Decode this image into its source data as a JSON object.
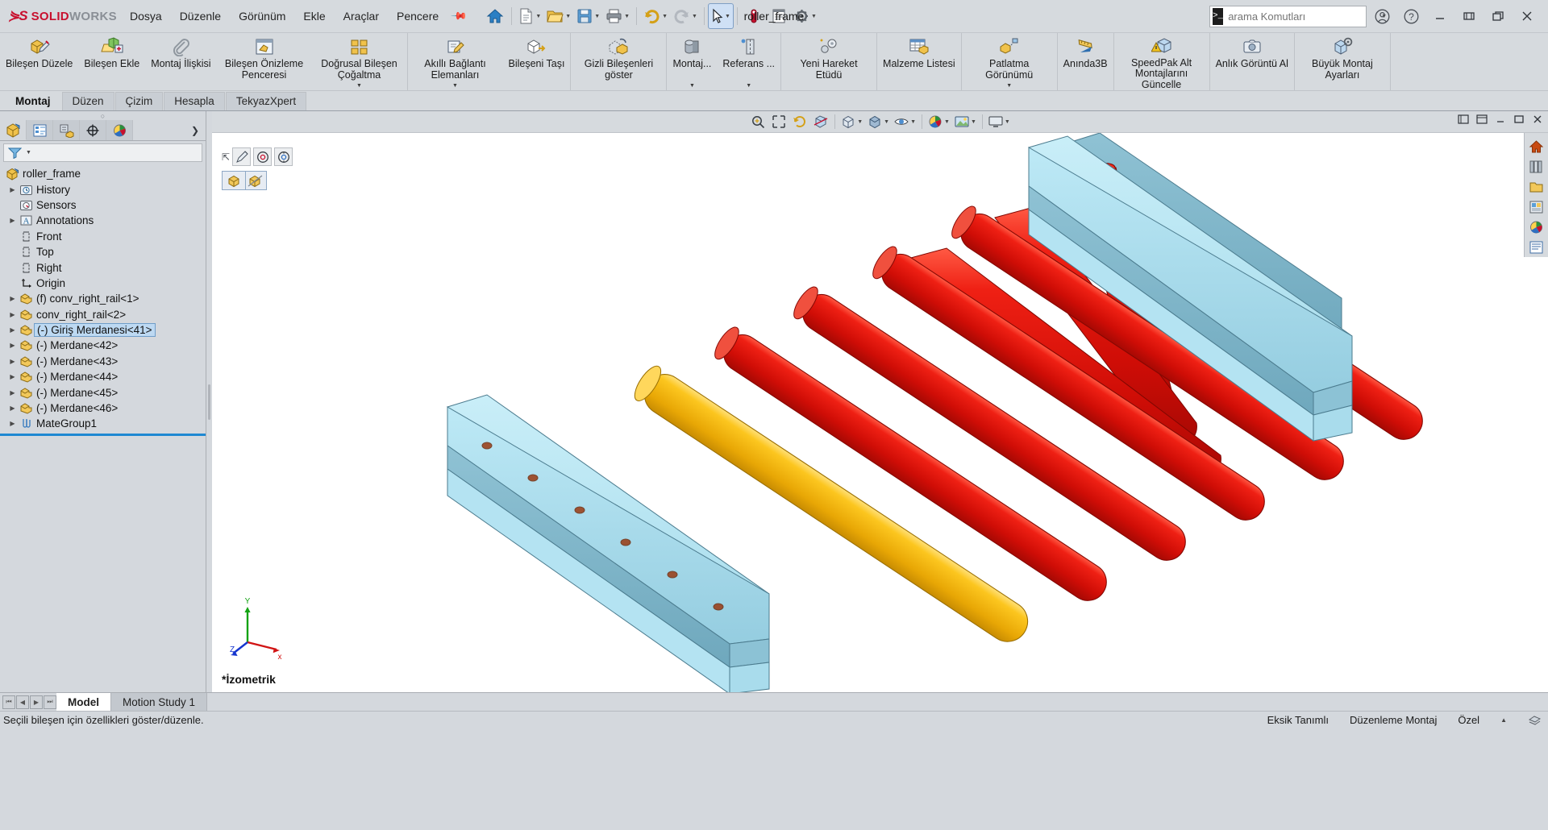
{
  "app": {
    "brand_ds": "2S",
    "brand_name_bold": "SOLID",
    "brand_name_light": "WORKS",
    "document_title": "roller_frame"
  },
  "menu": {
    "items": [
      {
        "label": "Dosya"
      },
      {
        "label": "Düzenle"
      },
      {
        "label": "Görünüm"
      },
      {
        "label": "Ekle"
      },
      {
        "label": "Araçlar"
      },
      {
        "label": "Pencere"
      }
    ],
    "pin_icon": "pushpin-icon"
  },
  "quick_access": [
    {
      "name": "home-icon",
      "label": "Ana Sayfa",
      "glyph": "home"
    },
    {
      "name": "new-document-icon",
      "label": "Yeni",
      "glyph": "newdoc",
      "dropdown": true
    },
    {
      "name": "open-folder-icon",
      "label": "Aç",
      "glyph": "open",
      "dropdown": true
    },
    {
      "name": "save-icon",
      "label": "Kaydet",
      "glyph": "save",
      "dropdown": true
    },
    {
      "name": "print-icon",
      "label": "Yazdır",
      "glyph": "print",
      "dropdown": true
    },
    {
      "name": "undo-icon",
      "label": "Geri Al",
      "glyph": "undo",
      "dropdown": true
    },
    {
      "name": "redo-icon",
      "label": "Yinele",
      "glyph": "redo",
      "dropdown": true
    },
    {
      "name": "select-cursor-icon",
      "label": "Seç",
      "glyph": "cursor",
      "dropdown": true,
      "selected": true
    },
    {
      "name": "measure-icon",
      "label": "Ölç",
      "glyph": "measure"
    },
    {
      "name": "display-panel-icon",
      "label": "Görüntü Paneli",
      "glyph": "panel"
    },
    {
      "name": "options-gear-icon",
      "label": "Seçenekler",
      "glyph": "gear",
      "dropdown": true
    }
  ],
  "search": {
    "placeholder": "arama Komutları",
    "value": "",
    "terminal_glyph": "❯_",
    "search_icon": "search-icon",
    "dropdown_icon": "chevron-down-icon"
  },
  "window_controls": [
    {
      "name": "account-icon",
      "glyph": "account"
    },
    {
      "name": "help-icon",
      "glyph": "help"
    },
    {
      "name": "minimize-button",
      "glyph": "minimize"
    },
    {
      "name": "restore-button",
      "glyph": "restore"
    },
    {
      "name": "maximize-button",
      "glyph": "maximize"
    },
    {
      "name": "close-button",
      "glyph": "close"
    }
  ],
  "ribbon": {
    "groups": [
      {
        "buttons": [
          {
            "name": "edit-component-button",
            "icon": "edit-component-icon",
            "label": "Bileşen Düzele"
          },
          {
            "name": "insert-component-button",
            "icon": "insert-component-icon",
            "label": "Bileşen Ekle"
          },
          {
            "name": "mate-button",
            "icon": "mate-paperclip-icon",
            "label": "Montaj İlişkisi"
          },
          {
            "name": "component-preview-button",
            "icon": "component-preview-icon",
            "label": "Bileşen Önizleme Penceresi"
          },
          {
            "name": "linear-component-pattern-button",
            "icon": "linear-pattern-icon",
            "label": "Doğrusal Bileşen Çoğaltma",
            "dropdown": true
          }
        ]
      },
      {
        "buttons": [
          {
            "name": "smart-fasteners-button",
            "icon": "smart-fasteners-icon",
            "label": "Akıllı Bağlantı Elemanları",
            "dropdown": true
          },
          {
            "name": "move-component-button",
            "icon": "move-component-icon",
            "label": "Bileşeni Taşı"
          }
        ]
      },
      {
        "buttons": [
          {
            "name": "show-hidden-components-button",
            "icon": "hidden-components-icon",
            "label": "Gizli Bileşenleri göster"
          }
        ]
      },
      {
        "buttons": [
          {
            "name": "assembly-features-button",
            "icon": "assembly-features-icon",
            "label": "Montaj...",
            "dropdown": true
          },
          {
            "name": "reference-geometry-button",
            "icon": "reference-geometry-icon",
            "label": "Referans ...",
            "dropdown": true
          }
        ]
      },
      {
        "buttons": [
          {
            "name": "new-motion-study-button",
            "icon": "motion-study-icon",
            "label": "Yeni Hareket Etüdü"
          }
        ]
      },
      {
        "buttons": [
          {
            "name": "bill-of-materials-button",
            "icon": "bom-icon",
            "label": "Malzeme Listesi"
          }
        ]
      },
      {
        "buttons": [
          {
            "name": "exploded-view-button",
            "icon": "exploded-view-icon",
            "label": "Patlatma Görünümü",
            "dropdown": true
          }
        ]
      },
      {
        "buttons": [
          {
            "name": "instant3d-button",
            "icon": "instant3d-ruler-icon",
            "label": "Anında3B"
          }
        ]
      },
      {
        "buttons": [
          {
            "name": "update-speedpak-button",
            "icon": "speedpak-icon",
            "label": "SpeedPak Alt Montajlarını Güncelle"
          }
        ]
      },
      {
        "buttons": [
          {
            "name": "snapshot-button",
            "icon": "camera-icon",
            "label": "Anlık Görüntü Al"
          }
        ]
      },
      {
        "buttons": [
          {
            "name": "large-assembly-settings-button",
            "icon": "large-assembly-icon",
            "label": "Büyük Montaj Ayarları"
          }
        ]
      }
    ]
  },
  "command_tabs": [
    {
      "name": "tab-montaj",
      "label": "Montaj",
      "active": true
    },
    {
      "name": "tab-duzen",
      "label": "Düzen",
      "active": false
    },
    {
      "name": "tab-cizim",
      "label": "Çizim",
      "active": false
    },
    {
      "name": "tab-hesapla",
      "label": "Hesapla",
      "active": false
    },
    {
      "name": "tab-tekyazxpert",
      "label": "TekyazXpert",
      "active": false
    }
  ],
  "feature_manager": {
    "tabs": [
      {
        "name": "feature-manager-tab",
        "icon": "feature-tree-icon",
        "active": true
      },
      {
        "name": "property-manager-tab",
        "icon": "property-list-icon",
        "active": false
      },
      {
        "name": "configuration-manager-tab",
        "icon": "configuration-icon",
        "active": false
      },
      {
        "name": "dimxpert-manager-tab",
        "icon": "dimxpert-icon",
        "active": false
      },
      {
        "name": "display-manager-tab",
        "icon": "display-palette-icon",
        "active": false
      }
    ],
    "expand_icon": "chevron-right-icon",
    "filter": {
      "icon": "filter-funnel-icon",
      "placeholder": "",
      "value": ""
    },
    "tree": [
      {
        "label": "roller_frame",
        "icon": "assembly-icon",
        "indent": 0,
        "expandable": false,
        "selected": false
      },
      {
        "label": "History",
        "icon": "history-folder-icon",
        "indent": 1,
        "expandable": true,
        "selected": false
      },
      {
        "label": "Sensors",
        "icon": "sensors-folder-icon",
        "indent": 1,
        "expandable": false,
        "selected": false
      },
      {
        "label": "Annotations",
        "icon": "annotations-icon",
        "indent": 1,
        "expandable": true,
        "selected": false
      },
      {
        "label": "Front",
        "icon": "plane-icon",
        "indent": 1,
        "expandable": false,
        "selected": false
      },
      {
        "label": "Top",
        "icon": "plane-icon",
        "indent": 1,
        "expandable": false,
        "selected": false
      },
      {
        "label": "Right",
        "icon": "plane-icon",
        "indent": 1,
        "expandable": false,
        "selected": false
      },
      {
        "label": "Origin",
        "icon": "origin-icon",
        "indent": 1,
        "expandable": false,
        "selected": false
      },
      {
        "label": "(f) conv_right_rail<1>",
        "icon": "part-icon",
        "indent": 1,
        "expandable": true,
        "selected": false
      },
      {
        "label": "conv_right_rail<2>",
        "icon": "part-icon",
        "indent": 1,
        "expandable": true,
        "selected": false
      },
      {
        "label": "(-) Giriş Merdanesi<41>",
        "icon": "part-icon",
        "indent": 1,
        "expandable": true,
        "selected": true
      },
      {
        "label": "(-) Merdane<42>",
        "icon": "part-icon",
        "indent": 1,
        "expandable": true,
        "selected": false
      },
      {
        "label": "(-) Merdane<43>",
        "icon": "part-icon",
        "indent": 1,
        "expandable": true,
        "selected": false
      },
      {
        "label": "(-) Merdane<44>",
        "icon": "part-icon",
        "indent": 1,
        "expandable": true,
        "selected": false
      },
      {
        "label": "(-) Merdane<45>",
        "icon": "part-icon",
        "indent": 1,
        "expandable": true,
        "selected": false
      },
      {
        "label": "(-) Merdane<46>",
        "icon": "part-icon",
        "indent": 1,
        "expandable": true,
        "selected": false
      },
      {
        "label": "MateGroup1",
        "icon": "mategroup-icon",
        "indent": 1,
        "expandable": true,
        "selected": false
      }
    ]
  },
  "view_toolbar": [
    {
      "name": "zoom-to-fit-button",
      "icon": "zoom-fit-icon"
    },
    {
      "name": "zoom-to-area-button",
      "icon": "zoom-area-icon"
    },
    {
      "name": "previous-view-button",
      "icon": "previous-view-icon"
    },
    {
      "name": "section-view-button",
      "icon": "section-view-icon"
    },
    {
      "name": "view-orientation-button",
      "icon": "view-orientation-icon",
      "dropdown": true
    },
    {
      "name": "display-style-button",
      "icon": "display-style-icon",
      "dropdown": true
    },
    {
      "name": "hide-show-items-button",
      "icon": "hide-show-icon",
      "dropdown": true
    },
    {
      "name": "edit-appearance-button",
      "icon": "appearance-icon",
      "dropdown": true
    },
    {
      "name": "apply-scene-button",
      "icon": "scene-icon",
      "dropdown": true
    },
    {
      "name": "view-settings-button",
      "icon": "view-settings-icon",
      "dropdown": true
    }
  ],
  "graphics_window_controls": [
    {
      "name": "gfx-restore-button",
      "glyph": "restore-small"
    },
    {
      "name": "gfx-tile-button",
      "glyph": "tile-small"
    },
    {
      "name": "gfx-minimize-button",
      "glyph": "minimize"
    },
    {
      "name": "gfx-maximize-button",
      "glyph": "maximize"
    },
    {
      "name": "gfx-close-button",
      "glyph": "close"
    }
  ],
  "context_toolbar": {
    "row1": [
      {
        "name": "context-handle-icon",
        "icon": "drag-handle-icon"
      },
      {
        "name": "edit-sketch-button",
        "icon": "pencil-icon"
      },
      {
        "name": "concentric-mate-button",
        "icon": "concentric-icon"
      },
      {
        "name": "concentric-lock-button",
        "icon": "concentric-lock-icon"
      }
    ],
    "row2": [
      {
        "name": "isolate-component-button",
        "icon": "isolate-part-icon"
      },
      {
        "name": "hide-component-button",
        "icon": "hide-part-icon"
      }
    ]
  },
  "viewport": {
    "orientation_label": "*İzometrik",
    "triad": {
      "x": "x",
      "y": "Y",
      "z": "Z",
      "x_color": "#d11414",
      "y_color": "#13a313",
      "z_color": "#1535cf"
    },
    "model": {
      "name": "roller_frame",
      "rail_color": "#b8e6f2",
      "rail_shade_color": "#7fb6c8",
      "roller_color": "#e01b10",
      "highlight_roller_color": "#f5b611",
      "roller_count": 6
    }
  },
  "right_dock": [
    {
      "name": "dock-home-icon",
      "icon": "home-icon"
    },
    {
      "name": "dock-design-library-icon",
      "icon": "design-library-icon"
    },
    {
      "name": "dock-file-explorer-icon",
      "icon": "file-explorer-icon"
    },
    {
      "name": "dock-view-palette-icon",
      "icon": "view-palette-icon"
    },
    {
      "name": "dock-appearances-icon",
      "icon": "appearances-icon"
    },
    {
      "name": "dock-custom-properties-icon",
      "icon": "custom-properties-icon"
    }
  ],
  "bottom_tabs": {
    "nav": [
      {
        "name": "first-tab-button",
        "glyph": "⏮"
      },
      {
        "name": "prev-tab-button",
        "glyph": "◀"
      },
      {
        "name": "next-tab-button",
        "glyph": "▶"
      },
      {
        "name": "last-tab-button",
        "glyph": "⏭"
      }
    ],
    "tabs": [
      {
        "name": "tab-model",
        "label": "Model",
        "active": true
      },
      {
        "name": "tab-motion-study-1",
        "label": "Motion Study 1",
        "active": false
      }
    ]
  },
  "status_bar": {
    "message": "Seçili bileşen için özellikleri göster/düzenle.",
    "under_defined": "Eksik Tanımlı",
    "mode": "Düzenleme Montaj",
    "units": "Özel",
    "units_caret": "▲",
    "overlay_icon": "overlay-icon"
  }
}
